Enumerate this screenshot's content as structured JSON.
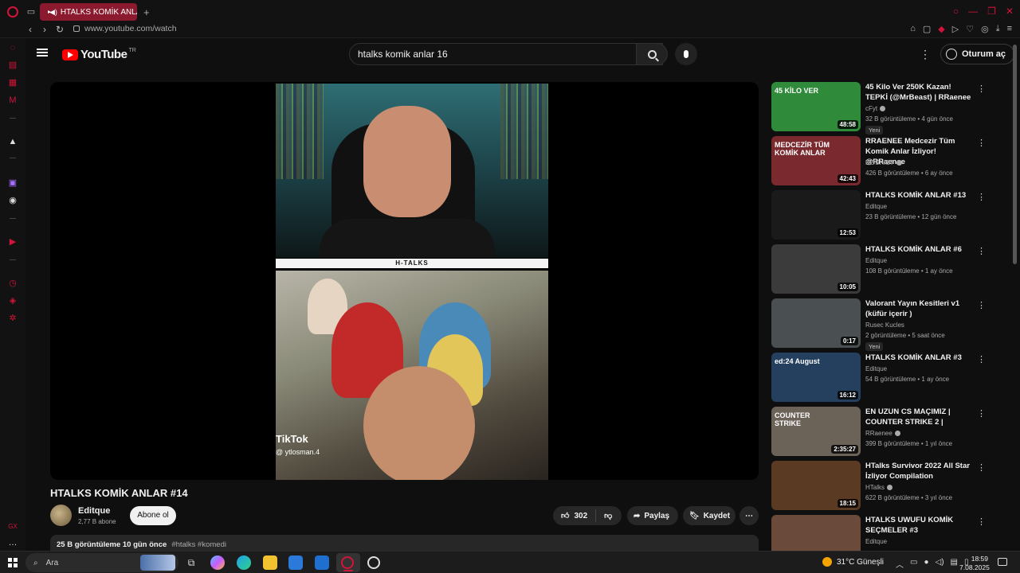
{
  "browser": {
    "tab_title": "HTALKS KOMİK ANLA",
    "url": "www.youtube.com/watch"
  },
  "youtube": {
    "logo_text": "YouTube",
    "region": "TR",
    "search_query": "htalks komik anlar 16",
    "signin_label": "Oturum aç"
  },
  "video": {
    "band_text": "H-TALKS",
    "tiktok_label": "TikTok",
    "tiktok_handle": "@ ytlosman.4",
    "title": "HTALKS KOMİK ANLAR #14",
    "channel": "Editque",
    "subscribers": "2,77 B abone",
    "subscribe_label": "Abone ol",
    "likes": "302",
    "share_label": "Paylaş",
    "save_label": "Kaydet",
    "views_date": "25 B görüntüleme  10 gün önce",
    "hashtags": "#htalks #komedi"
  },
  "recommendations": [
    {
      "title": "45 Kilo Ver 250K Kazan! TEPKİ (@MrBeast) | RRaenee",
      "channel": "cFyt",
      "verified": true,
      "meta": "32 B görüntüleme • 4 gün önce",
      "badge": "Yeni",
      "duration": "48:58",
      "thumb_text": "45 KİLO VER",
      "thumb_color": "#2f8a3a"
    },
    {
      "title": "RRAENEE Medcezir Tüm Komik Anlar İzliyor! @RRaenee",
      "channel": "ROSHIST",
      "verified": true,
      "meta": "426 B görüntüleme • 6 ay önce",
      "badge": "",
      "duration": "42:43",
      "thumb_text": "MEDCEZİR TÜM KOMİK ANLAR",
      "thumb_color": "#7a2a2e"
    },
    {
      "title": "HTALKS KOMİK ANLAR  #13",
      "channel": "Editque",
      "verified": false,
      "meta": "23 B görüntüleme • 12 gün önce",
      "badge": "",
      "duration": "12:53",
      "thumb_text": "",
      "thumb_color": "#1a1a1a"
    },
    {
      "title": "HTALKS KOMİK ANLAR #6",
      "channel": "Editque",
      "verified": false,
      "meta": "108 B görüntüleme • 1 ay önce",
      "badge": "",
      "duration": "10:05",
      "thumb_text": "",
      "thumb_color": "#3b3b3b"
    },
    {
      "title": "Valorant Yayın Kesitleri  v1 (küfür içerir )",
      "channel": "Rusec Kucles",
      "verified": false,
      "meta": "2 görüntüleme • 5 saat önce",
      "badge": "Yeni",
      "duration": "0:17",
      "thumb_text": "",
      "thumb_color": "#4a4f52"
    },
    {
      "title": "HTALKS KOMİK ANLAR #3",
      "channel": "Editque",
      "verified": false,
      "meta": "54 B görüntüleme • 1 ay önce",
      "badge": "",
      "duration": "16:12",
      "thumb_text": "ed:24 August",
      "thumb_color": "#24405e"
    },
    {
      "title": "EN UZUN CS MAÇIMIZ | COUNTER STRIKE 2 |",
      "channel": "RRaenee",
      "verified": true,
      "meta": "399 B görüntüleme • 1 yıl önce",
      "badge": "",
      "duration": "2:35:27",
      "thumb_text": "COUNTER STRIKE",
      "thumb_color": "#6b6258"
    },
    {
      "title": "HTalks Survivor 2022 All Star İzliyor Compilation",
      "channel": "HTalks",
      "verified": true,
      "meta": "622 B görüntüleme • 3 yıl önce",
      "badge": "",
      "duration": "18:15",
      "thumb_text": "",
      "thumb_color": "#5a3a22"
    },
    {
      "title": "HTALKS UWUFU KOMİK SEÇMELER #3",
      "channel": "Editque",
      "verified": false,
      "meta": "",
      "badge": "",
      "duration": "",
      "thumb_text": "",
      "thumb_color": "#6a4a3a"
    }
  ],
  "taskbar": {
    "search_label": "Ara",
    "weather": "31°C  Güneşli",
    "time": "18:59",
    "date": "7.08.2025"
  },
  "colors": {
    "opera_red": "#d2143a",
    "yt_red": "#ff0000",
    "bg": "#0f0f0f"
  }
}
